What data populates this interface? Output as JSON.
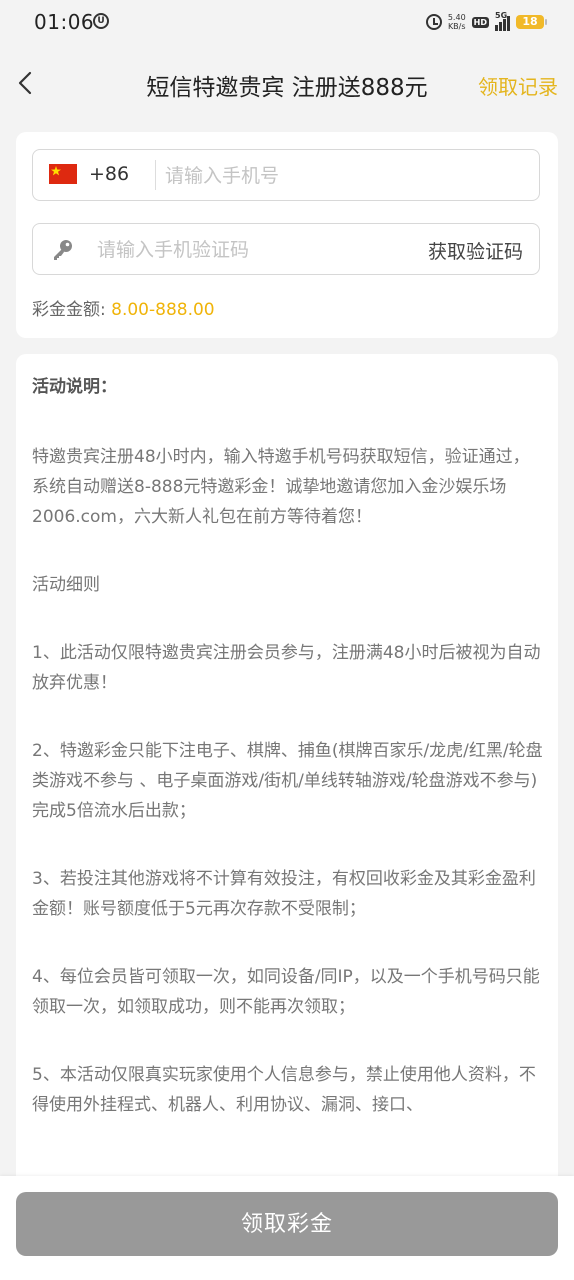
{
  "status_bar": {
    "time": "01:06",
    "speed_value": "5.40",
    "speed_unit": "KB/s",
    "hd": "HD",
    "network": "5G",
    "battery": "18"
  },
  "header": {
    "title": "短信特邀贵宾 注册送888元",
    "action_label": "领取记录"
  },
  "form": {
    "country_code": "+86",
    "phone_placeholder": "请输入手机号",
    "code_placeholder": "请输入手机验证码",
    "get_code_label": "获取验证码",
    "bonus_label": "彩金金额: ",
    "bonus_value": "8.00-888.00"
  },
  "description": {
    "title": "活动说明：",
    "paragraphs": [
      "特邀贵宾注册48小时内，输入特邀手机号码获取短信，验证通过，系统自动赠送8-888元特邀彩金！诚挚地邀请您加入金沙娱乐场2006.com，六大新人礼包在前方等待着您！",
      "活动细则",
      "1、此活动仅限特邀贵宾注册会员参与，注册满48小时后被视为自动放弃优惠！",
      "2、特邀彩金只能下注电子、棋牌、捕鱼(棋牌百家乐/龙虎/红黑/轮盘类游戏不参与 、电子桌面游戏/街机/单线转轴游戏/轮盘游戏不参与)完成5倍流水后出款；",
      "3、若投注其他游戏将不计算有效投注，有权回收彩金及其彩金盈利金额！账号额度低于5元再次存款不受限制；",
      "4、每位会员皆可领取一次，如同设备/同IP，以及一个手机号码只能领取一次，如领取成功，则不能再次领取；",
      "5、本活动仅限真实玩家使用个人信息参与，禁止使用他人资料，不得使用外挂程式、机器人、利用协议、漏洞、接口、"
    ]
  },
  "footer": {
    "claim_label": "领取彩金"
  },
  "colors": {
    "accent": "#e4b51e",
    "bonus": "#f0b40a",
    "button_disabled": "#999999",
    "background": "#f3f3f3"
  }
}
